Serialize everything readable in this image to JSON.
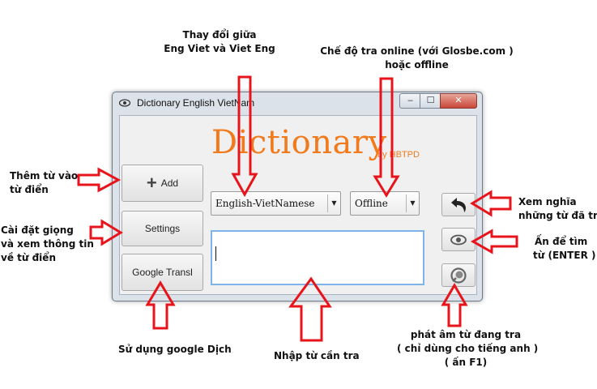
{
  "window": {
    "title": "Dictionary English VietNam",
    "min_label": "–",
    "max_label": "☐",
    "close_label": "✕"
  },
  "logo": {
    "text": "Dictionary",
    "byline": "by HBTPD"
  },
  "buttons": {
    "add": "Add",
    "settings": "Settings",
    "google": "Google Transl"
  },
  "combos": {
    "language": "English-VietNamese",
    "mode": "Offline"
  },
  "search": {
    "value": ""
  },
  "icons": [
    "eye-icon",
    "back-arrow-icon",
    "speaker-icon"
  ],
  "annotations": {
    "top_swap_1": "Thay đổi giữa",
    "top_swap_2": "Eng Viet và Viet Eng",
    "top_mode_1": "Chế độ tra online (với Glosbe.com )",
    "top_mode_2": "hoặc offline",
    "left_add_1": "Thêm từ vào",
    "left_add_2": "từ điển",
    "left_settings_1": "Cài đặt giọng",
    "left_settings_2": "và xem thông tin",
    "left_settings_3": "về từ điển",
    "right_history_1": "Xem nghĩa",
    "right_history_2": "những từ đã tra",
    "right_find_1": "Ấn để tìm",
    "right_find_2": "từ  (ENTER )",
    "bottom_google": "Sử dụng google Dịch",
    "bottom_input": "Nhập từ cần tra",
    "bottom_speak_1": "phát âm từ đang tra",
    "bottom_speak_2": "( chỉ dùng cho tiếng anh )",
    "bottom_speak_3": "( ấn F1)"
  },
  "colors": {
    "arrow": "#e8141c",
    "logo": "#f07a1c",
    "input_border": "#7eb4ea"
  }
}
